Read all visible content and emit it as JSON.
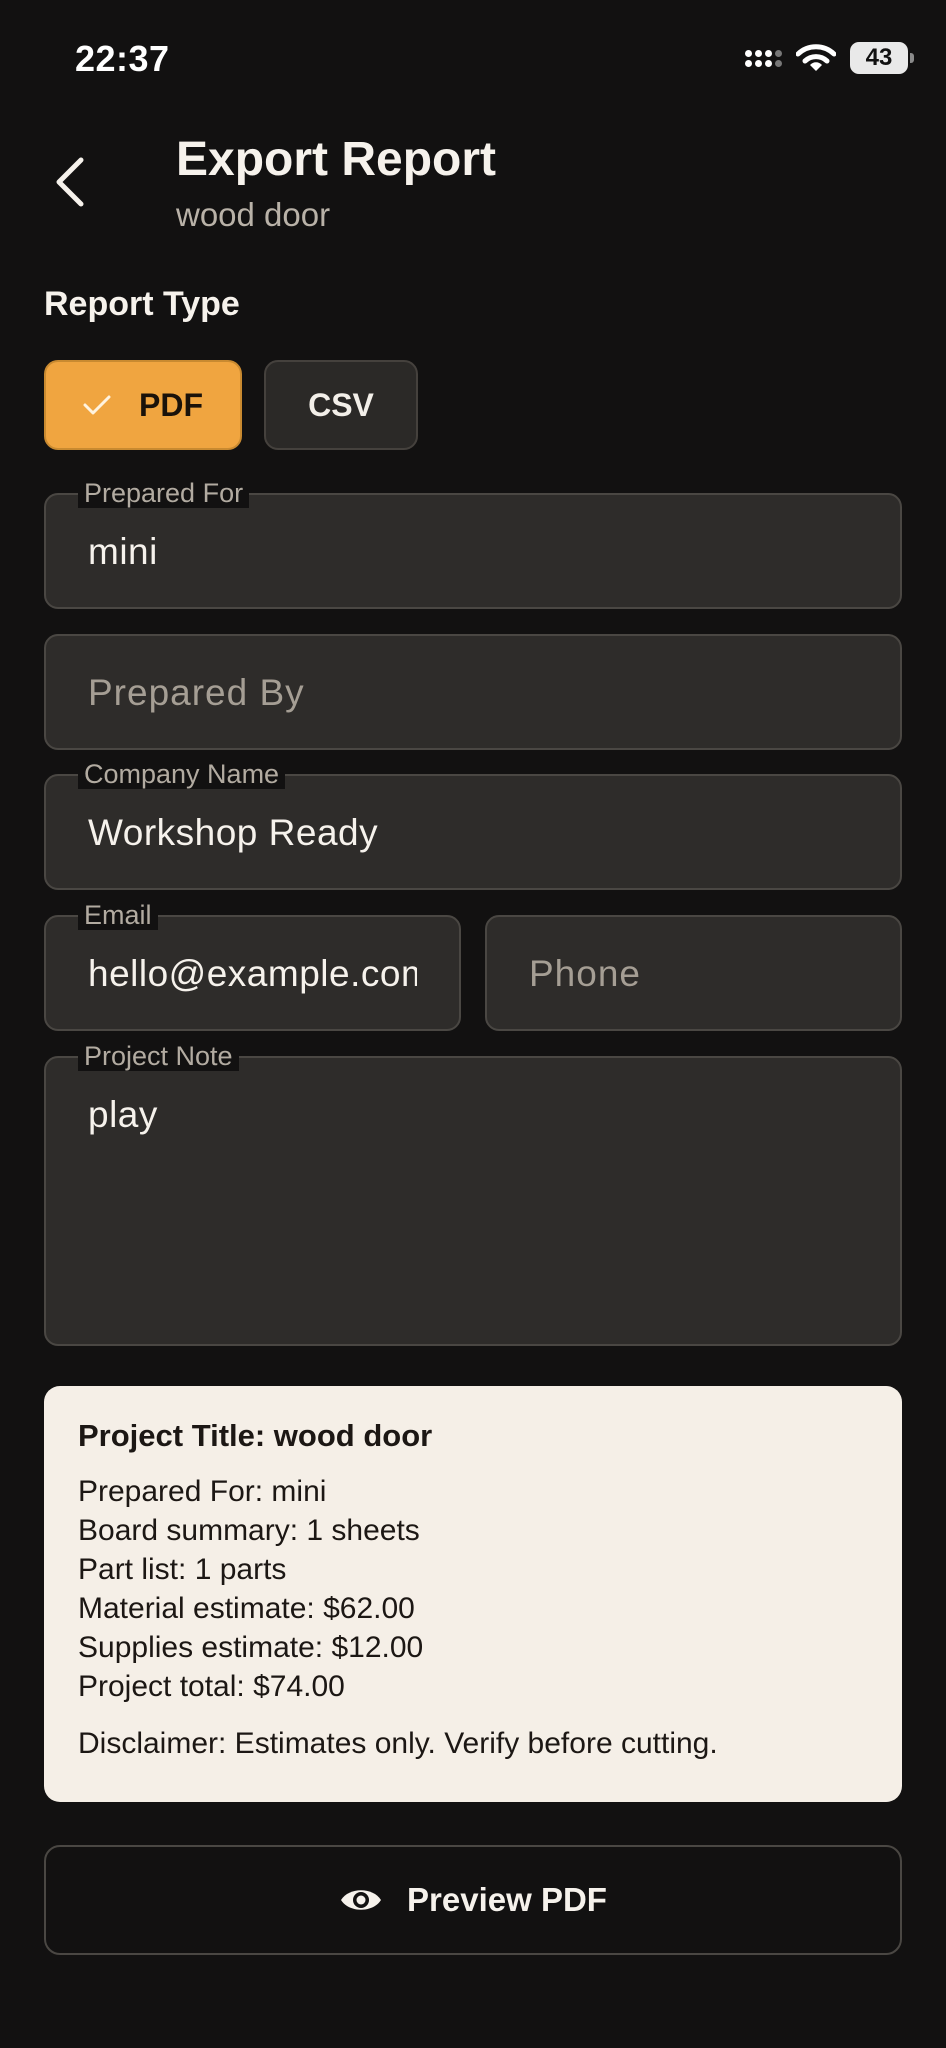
{
  "status_bar": {
    "time": "22:37",
    "battery": "43"
  },
  "header": {
    "title": "Export Report",
    "subtitle": "wood door"
  },
  "report_type": {
    "label": "Report Type",
    "options": [
      {
        "label": "PDF",
        "selected": true
      },
      {
        "label": "CSV",
        "selected": false
      }
    ]
  },
  "form": {
    "prepared_for": {
      "label": "Prepared For",
      "value": "mini"
    },
    "prepared_by": {
      "placeholder": "Prepared By"
    },
    "company_name": {
      "label": "Company Name",
      "value": "Workshop Ready"
    },
    "email": {
      "label": "Email",
      "value": "hello@example.com"
    },
    "phone": {
      "placeholder": "Phone"
    },
    "project_note": {
      "label": "Project Note",
      "value": "play"
    }
  },
  "summary": {
    "title": "Project Title: wood door",
    "lines": [
      "Prepared For: mini",
      "Board summary: 1 sheets",
      "Part list: 1 parts",
      "Material estimate: $62.00",
      "Supplies estimate: $12.00",
      "Project total: $74.00"
    ],
    "disclaimer": "Disclaimer: Estimates only. Verify before cutting."
  },
  "actions": {
    "preview_label": "Preview PDF"
  },
  "colors": {
    "accent": "#f0a540",
    "background": "#121111",
    "card": "#f5efe7"
  }
}
